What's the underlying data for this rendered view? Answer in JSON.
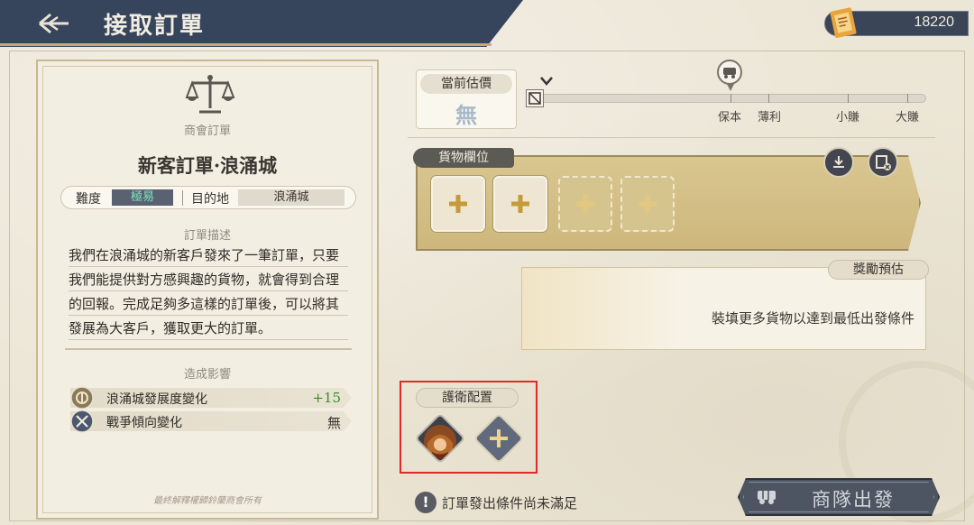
{
  "header": {
    "title": "接取訂單"
  },
  "currency": {
    "value": "18220",
    "icon": "order-ticket-icon"
  },
  "order": {
    "category": "商會訂單",
    "title": "新客訂單·浪涌城",
    "difficulty_label": "難度",
    "difficulty_value": "極易",
    "destination_label": "目的地",
    "destination_value": "浪涌城",
    "description_label": "訂單描述",
    "description": "我們在浪涌城的新客戶發來了一筆訂單，只要我們能提供對方感興趣的貨物，就會得到合理的回報。完成足夠多這樣的訂單後，可以將其發展為大客戶，獲取更大的訂單。",
    "effects_label": "造成影響",
    "effects": [
      {
        "name": "浪涌城發展度變化",
        "value": "+15",
        "icon": "city-development-icon",
        "color": "#3d8a2a"
      },
      {
        "name": "戰爭傾向變化",
        "value": "無",
        "icon": "war-tendency-icon",
        "color": "#3a3530"
      }
    ],
    "footnote": "最終解釋權歸鈴蘭商會所有"
  },
  "estimate": {
    "label": "當前估價",
    "value": "無",
    "tiers": [
      "保本",
      "薄利",
      "小賺",
      "大賺"
    ]
  },
  "cargo": {
    "label": "貨物欄位",
    "slots": [
      {
        "state": "unlocked",
        "icon": "plus-icon"
      },
      {
        "state": "unlocked",
        "icon": "plus-icon"
      },
      {
        "state": "locked",
        "icon": "plus-icon"
      },
      {
        "state": "locked",
        "icon": "plus-icon"
      }
    ],
    "actions": [
      {
        "icon": "download-icon"
      },
      {
        "icon": "clear-cargo-icon"
      }
    ]
  },
  "reward": {
    "label": "獎勵預估",
    "message": "裝填更多貨物以達到最低出發條件"
  },
  "escort": {
    "label": "護衛配置",
    "members": [
      {
        "icon": "escort-portrait-icon"
      },
      {
        "icon": "add-escort-icon"
      }
    ]
  },
  "warning": {
    "text": "訂單發出條件尚未滿足"
  },
  "depart": {
    "label": "商隊出發"
  },
  "colors": {
    "header": "#36445c",
    "accent": "#c7a973",
    "highlight": "#e02a2a"
  }
}
